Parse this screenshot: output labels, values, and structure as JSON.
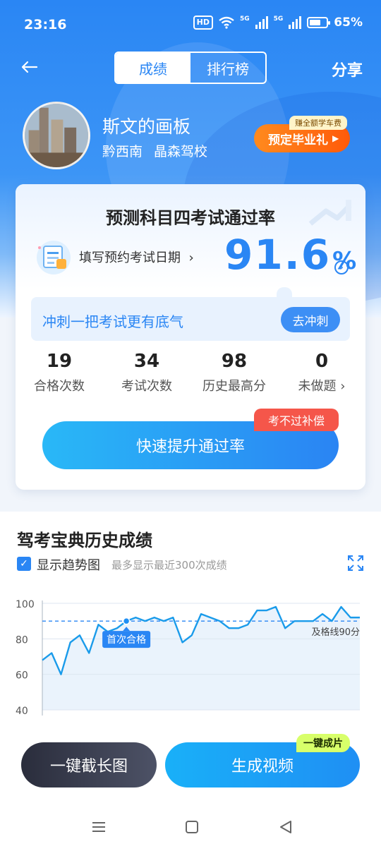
{
  "status_bar": {
    "time": "23:16",
    "hd": "HD",
    "net1": "5G",
    "net2": "5G",
    "battery": "65%",
    "battery_level": 0.65
  },
  "nav": {
    "tabs": [
      "成绩",
      "排行榜"
    ],
    "active_tab": 0,
    "share": "分享"
  },
  "profile": {
    "name": "斯文的画板",
    "region": "黔西南",
    "school": "晶森驾校"
  },
  "promo": {
    "label": "预定毕业礼",
    "tag": "赚全额学车费"
  },
  "card": {
    "title": "预测科目四考试通过率",
    "fill_date": "填写预约考试日期",
    "rate_value": "91.6",
    "rate_unit": "%",
    "sprint_text": "冲刺一把考试更有底气",
    "sprint_btn": "去冲刺",
    "stats": [
      {
        "value": "19",
        "label": "合格次数"
      },
      {
        "value": "34",
        "label": "考试次数"
      },
      {
        "value": "98",
        "label": "历史最高分"
      },
      {
        "value": "0",
        "label": "未做题"
      }
    ],
    "boost_btn": "快速提升通过率",
    "refund_tag": "考不过补偿"
  },
  "history": {
    "title": "驾考宝典历史成绩",
    "trend_label": "显示趋势图",
    "trend_note": "最多显示最近300次成绩"
  },
  "chart_data": {
    "type": "line",
    "y_ticks": [
      100,
      80,
      60,
      40
    ],
    "ylim": [
      40,
      100
    ],
    "pass_line": 90,
    "pass_label": "及格线90分",
    "first_pass_label": "首次合格",
    "first_pass_index": 9,
    "values": [
      68,
      72,
      60,
      78,
      82,
      72,
      88,
      84,
      86,
      90,
      92,
      90,
      92,
      90,
      92,
      78,
      82,
      94,
      92,
      90,
      86,
      86,
      88,
      96,
      96,
      98,
      86,
      90,
      90,
      90,
      94,
      90,
      98,
      92,
      92
    ],
    "colors": {
      "line": "#1a9bea",
      "area": "#eaf3fc",
      "pass_line": "#2a86f4"
    }
  },
  "actions": {
    "long_screenshot": "一键截长图",
    "make_video": "生成视频",
    "video_tag": "一键成片"
  }
}
